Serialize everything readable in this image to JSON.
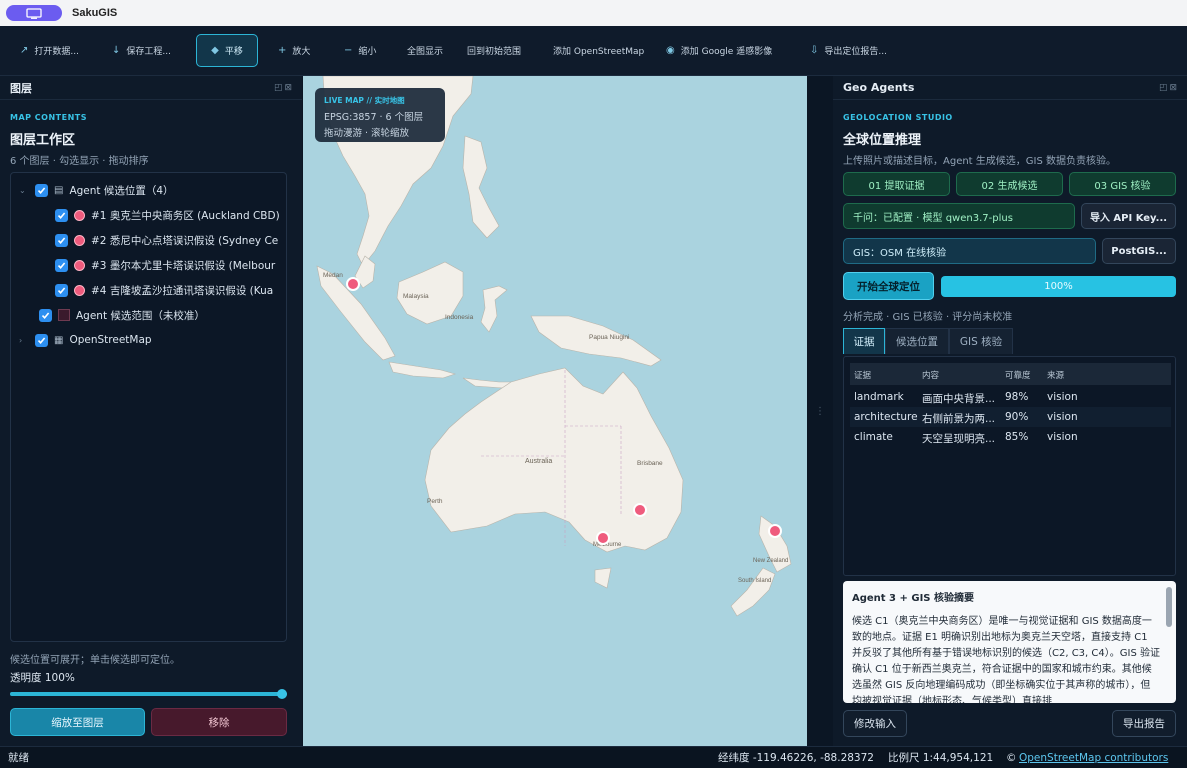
{
  "app": {
    "title": "SakuGIS"
  },
  "toolbar": {
    "open_data": "打开数据...",
    "save_project": "保存工程...",
    "pan": "平移",
    "zoom_in": "放大",
    "zoom_out": "缩小",
    "full_extent": "全图显示",
    "initial_extent": "回到初始范围",
    "add_osm": "添加 OpenStreetMap",
    "add_google": "添加 Google 遥感影像",
    "export_report": "导出定位报告..."
  },
  "layers_panel": {
    "title": "图层",
    "eyebrow": "MAP CONTENTS",
    "heading": "图层工作区",
    "subtitle": "6 个图层 · 勾选显示 · 拖动排序",
    "group_label": "Agent 候选位置（4）",
    "candidates": [
      "#1 奥克兰中央商务区 (Auckland CBD)",
      "#2 悉尼中心点塔误识假设 (Sydney Ce",
      "#3 墨尔本尤里卡塔误识假设 (Melbour",
      "#4 吉隆坡孟沙拉通讯塔误识假设 (Kua"
    ],
    "range_layer": "Agent 候选范围（未校准）",
    "osm_layer": "OpenStreetMap",
    "hint": "候选位置可展开；单击候选即可定位。",
    "opacity_label": "透明度 100%",
    "opacity_value": 1.0,
    "zoom_button": "缩放至图层",
    "remove_button": "移除"
  },
  "map": {
    "live_label": "LIVE MAP // 实时地图",
    "epsg_line": "EPSG:3857 · 6 个图层",
    "hint_line": "拖动漫游 · 滚轮缩放",
    "labels": {
      "australia": "Australia",
      "brisbane": "Brisbane",
      "perth": "Perth",
      "melbourne": "Melbourne",
      "papua": "Papua Niugini",
      "indonesia": "Indonesia",
      "malaysia": "Malaysia",
      "new_zealand": "New Zealand",
      "south_island": "South Island",
      "medan": "Medan"
    },
    "markers": [
      {
        "name": "Kuala Lumpur"
      },
      {
        "name": "Sydney"
      },
      {
        "name": "Melbourne"
      },
      {
        "name": "Auckland"
      }
    ]
  },
  "agents_panel": {
    "title": "Geo Agents",
    "eyebrow": "GEOLOCATION STUDIO",
    "heading": "全球位置推理",
    "subtitle": "上传照片或描述目标，Agent 生成候选，GIS 数据负责核验。",
    "steps": [
      "01 提取证据",
      "02 生成候选",
      "03 GIS 核验"
    ],
    "model_field": "千问：已配置 · 模型 qwen3.7-plus",
    "import_api_button": "导入 API Key...",
    "gis_field": "GIS：OSM 在线核验",
    "postgis_button": "PostGIS...",
    "start_button": "开始全球定位",
    "progress_label": "100%",
    "progress_value": 1.0,
    "status": "分析完成 · GIS 已核验 · 评分尚未校准",
    "tabs": [
      "证据",
      "候选位置",
      "GIS 核验"
    ],
    "evidence_headers": [
      "证据",
      "内容",
      "可靠度",
      "来源"
    ],
    "evidence_rows": [
      [
        "landmark",
        "画面中央背景...",
        "98%",
        "vision"
      ],
      [
        "architecture",
        "右侧前景为两...",
        "90%",
        "vision"
      ],
      [
        "climate",
        "天空呈现明亮...",
        "85%",
        "vision"
      ]
    ],
    "summary_title": "Agent 3 + GIS 核验摘要",
    "summary_body": "候选 C1（奥克兰中央商务区）是唯一与视觉证据和 GIS 数据高度一致的地点。证据 E1 明确识别出地标为奥克兰天空塔，直接支持 C1 并反驳了其他所有基于错误地标识别的候选（C2, C3, C4）。GIS 验证确认 C1 位于新西兰奥克兰，符合证据中的国家和城市约束。其他候选虽然 GIS 反向地理编码成功（即坐标确实位于其声称的城市），但均被视觉证据（地标形态、气候类型）直接排",
    "modify_button": "修改输入",
    "export_button": "导出报告"
  },
  "statusbar": {
    "ready": "就绪",
    "coords": "经纬度 -119.46226, -88.28372",
    "scale": "比例尺 1:44,954,121",
    "copyright_symbol": "©",
    "osm_link": "OpenStreetMap contributors"
  },
  "colors": {
    "accent": "#2cb5d6",
    "marker": "#ef5b7d",
    "water": "#aad3df",
    "land": "#f2efe9"
  }
}
